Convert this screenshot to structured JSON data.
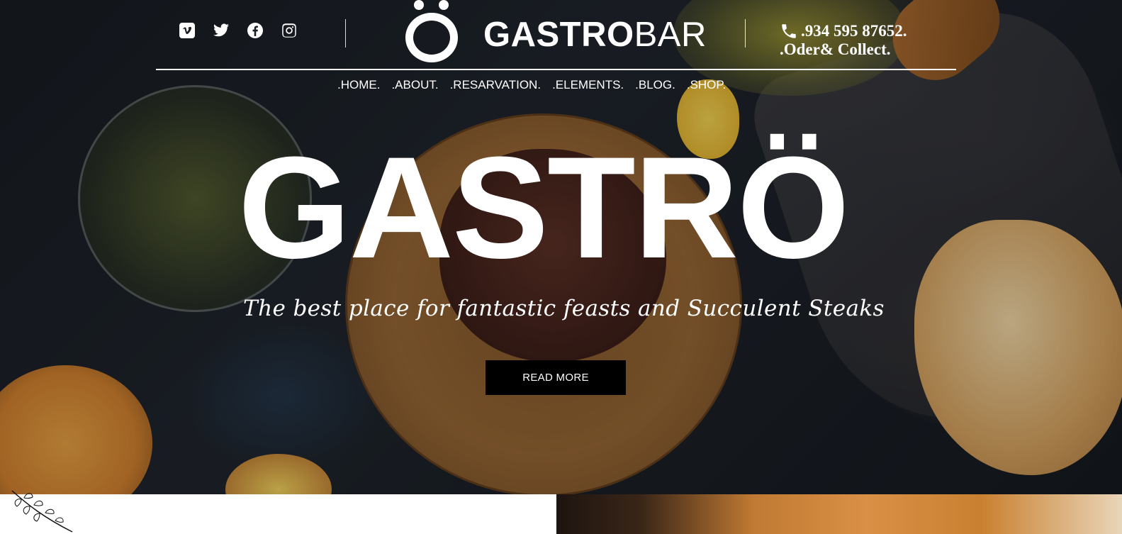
{
  "brand": {
    "logo_bold": "GASTRO",
    "logo_light": "BAR"
  },
  "social": [
    {
      "name": "vimeo-icon"
    },
    {
      "name": "twitter-icon"
    },
    {
      "name": "facebook-icon"
    },
    {
      "name": "instagram-icon"
    }
  ],
  "contact": {
    "phone": ".934 595 87652.",
    "note": ".Oder& Collect."
  },
  "nav": {
    "items": [
      ".HOME.",
      ".ABOUT.",
      ".RESARVATION.",
      ".ELEMENTS.",
      ".BLOG.",
      ".SHOP."
    ]
  },
  "hero": {
    "title": "GASTRÖ",
    "tagline": "The best place for fantastic feasts and Succulent Steaks",
    "button": "READ MORE"
  },
  "colors": {
    "text": "#ffffff",
    "button_bg": "#000000"
  }
}
